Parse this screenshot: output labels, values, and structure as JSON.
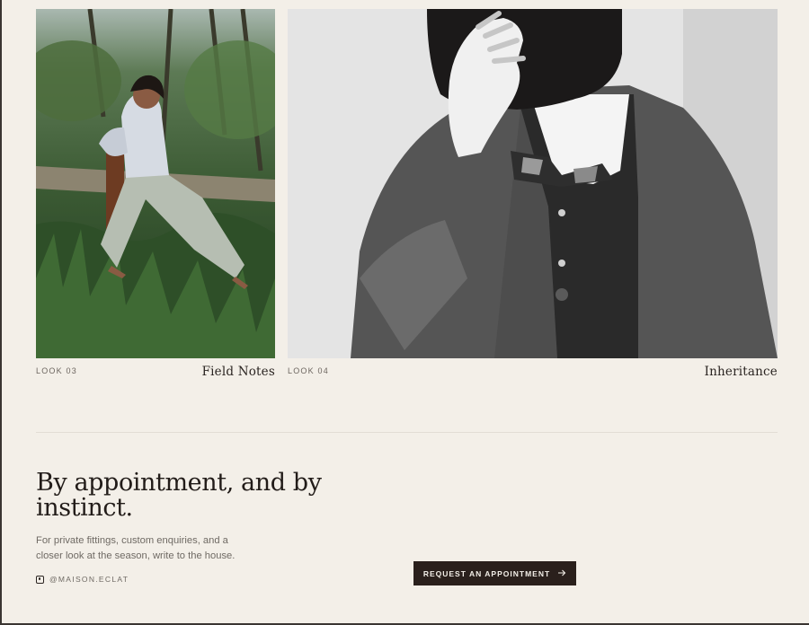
{
  "looks": [
    {
      "number": "LOOK 03",
      "title": "Field Notes",
      "image": "woman-in-garden-photo"
    },
    {
      "number": "LOOK 04",
      "title": "Inheritance",
      "image": "person-in-tweed-jacket-photo"
    }
  ],
  "appointment": {
    "heading": "By appointment, and by instinct.",
    "body": "For private fittings, custom enquiries, and a closer look at the season, write to the house.",
    "social_handle": "@MAISON.ECLAT",
    "social_icon": "instagram-icon",
    "cta_label": "REQUEST AN APPOINTMENT",
    "cta_icon": "arrow-right-icon"
  },
  "colors": {
    "background": "#f3efe8",
    "ink": "#2a2421",
    "button": "#2a201c",
    "muted": "#6f6a64"
  }
}
